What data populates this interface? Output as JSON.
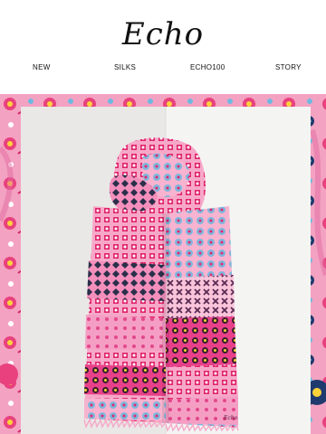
{
  "brand": {
    "logo_text": "Echo"
  },
  "nav": {
    "items": [
      {
        "label": "NEW"
      },
      {
        "label": "SILKS"
      },
      {
        "label": "ECHO100"
      },
      {
        "label": "STORY"
      }
    ]
  },
  "hero": {
    "image": "pink patterned silk scarf on light backdrop",
    "scarf_signature": "Echo",
    "colors": {
      "pink": "#f06aa8",
      "light_pink": "#f7a8c8",
      "backdrop": "#ececec"
    }
  }
}
